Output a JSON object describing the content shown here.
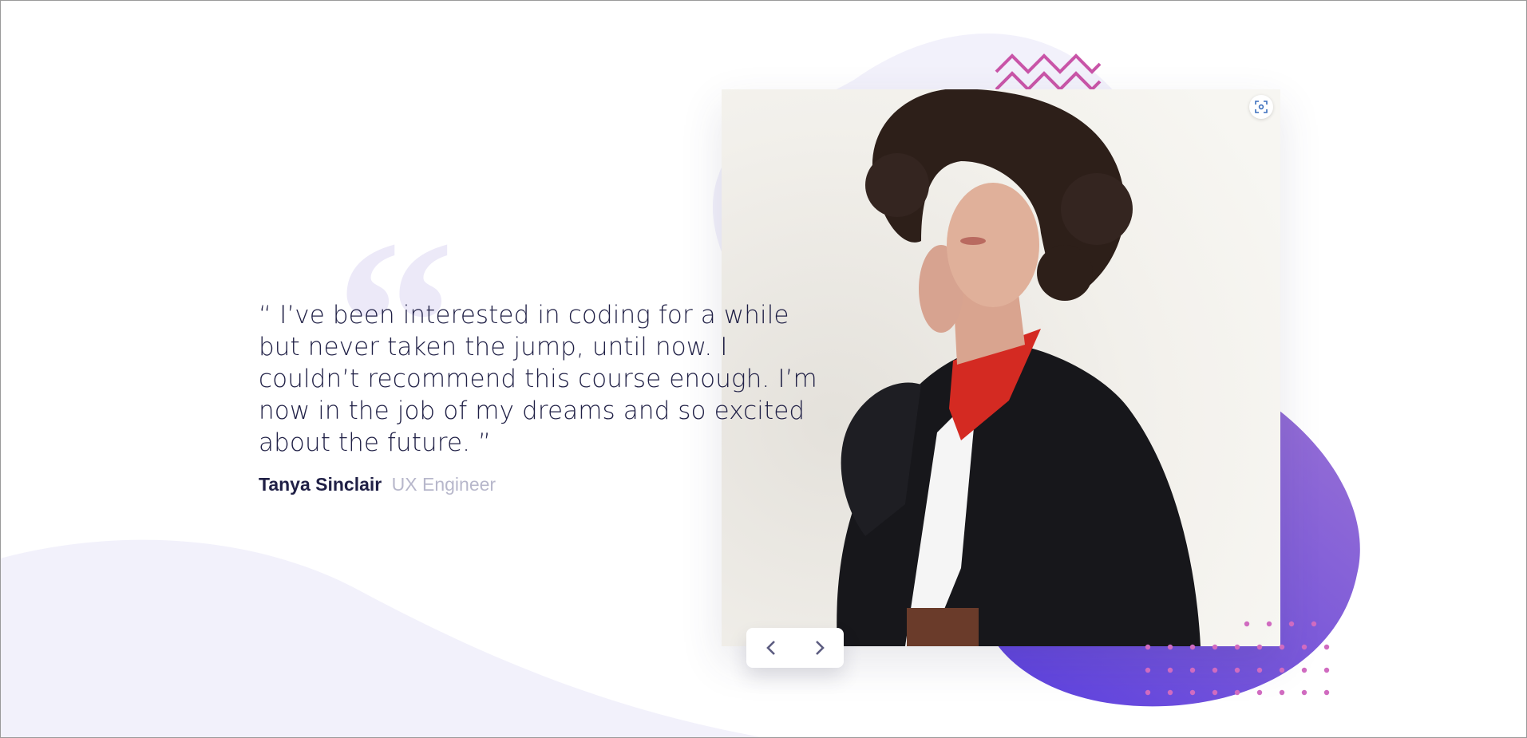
{
  "testimonial": {
    "quote": "“ I’ve been interested in coding for a while but never taken the jump, until now. I couldn’t recommend this course enough. I’m now in the job of my dreams and so excited about the future. ”",
    "author_name": "Tanya Sinclair",
    "author_role": "UX Engineer",
    "quote_mark": "“"
  },
  "navigation": {
    "prev_icon": "chevron-left-icon",
    "next_icon": "chevron-right-icon"
  },
  "photo": {
    "focus_icon": "focus-frame-icon"
  },
  "colors": {
    "text_dark": "#202046",
    "text_muted": "#b7b7cb",
    "quote_mark": "#ece9f8",
    "blob_light": "#f2f1fb",
    "blob_gradient_start": "#6a4fe0",
    "blob_gradient_end": "#8c66d6",
    "accent_pink": "#c955a8",
    "dot_pink": "#d06bc0"
  }
}
